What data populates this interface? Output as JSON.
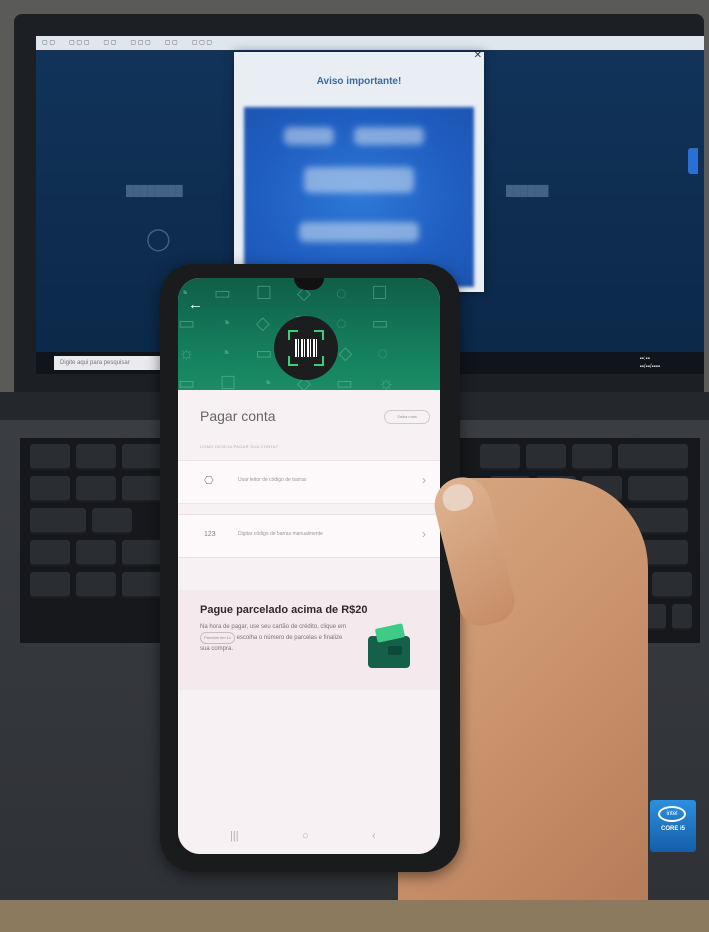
{
  "laptop": {
    "modal_title": "Aviso importante!",
    "taskbar_search_placeholder": "Digite aqui para pesquisar",
    "brand_sticker": {
      "line1": "intel",
      "line2": "CORE i5"
    }
  },
  "phone_app": {
    "page_title": "Pagar conta",
    "help_chip": "Saiba mais",
    "section_label": "COMO DESEJA PAGAR SUA CONTA?",
    "options": [
      {
        "icon": "camera-icon",
        "glyph": "⎔",
        "label": "Usar leitor de código de barras"
      },
      {
        "icon": "keypad-icon",
        "glyph": "123",
        "label": "Digitar código de barras manualmente"
      }
    ],
    "promo": {
      "title": "Pague parcelado acima de R$20",
      "body_before": "Na hora de pagar, use seu cartão de crédito, clique em",
      "chip": "Parcelar em 1x",
      "body_after": "escolha o número de parcelas e finalize sua compra."
    },
    "nav": {
      "recents": "|||",
      "home": "○",
      "back": "‹"
    },
    "colors": {
      "header_green": "#147a5a",
      "accent_green": "#3ad07a"
    }
  }
}
